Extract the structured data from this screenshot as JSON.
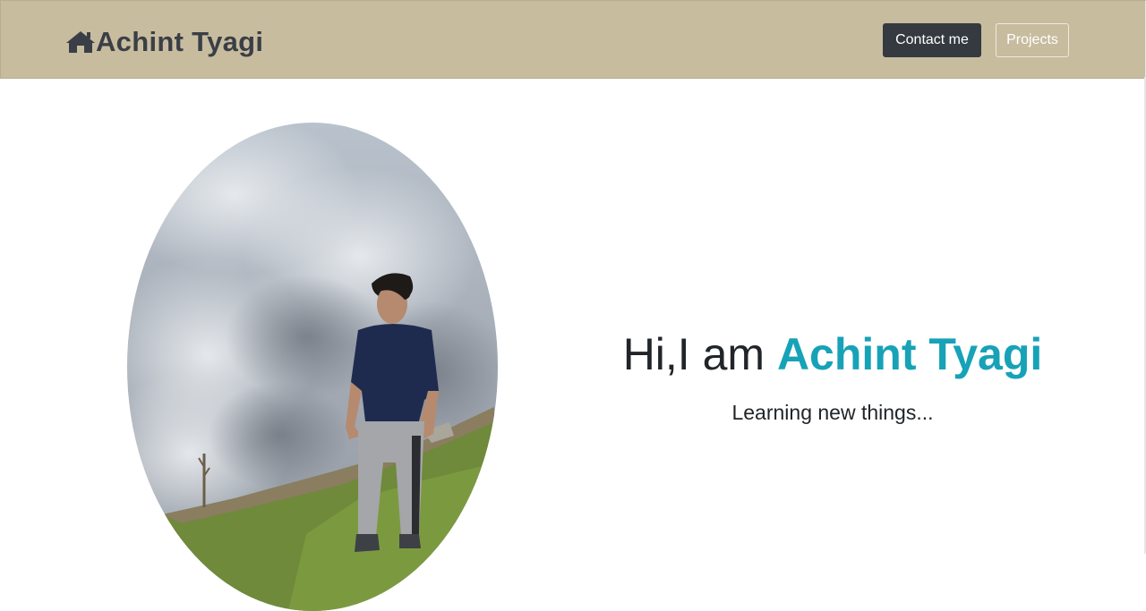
{
  "navbar": {
    "brand": {
      "icon": "home-icon",
      "label": "Achint Tyagi"
    },
    "contact_button": "Contact me",
    "projects_button": "Projects",
    "colors": {
      "background": "#c8bc9f",
      "brand_text": "#3a3f47",
      "contact_bg": "#343a40"
    }
  },
  "hero": {
    "photo": {
      "description_icon": "profile-photo"
    },
    "greeting_prefix": "Hi,I am ",
    "greeting_name": "Achint Tyagi",
    "tagline": "Learning new things...",
    "colors": {
      "name_accent": "#17a2b8",
      "text": "#212529"
    }
  }
}
